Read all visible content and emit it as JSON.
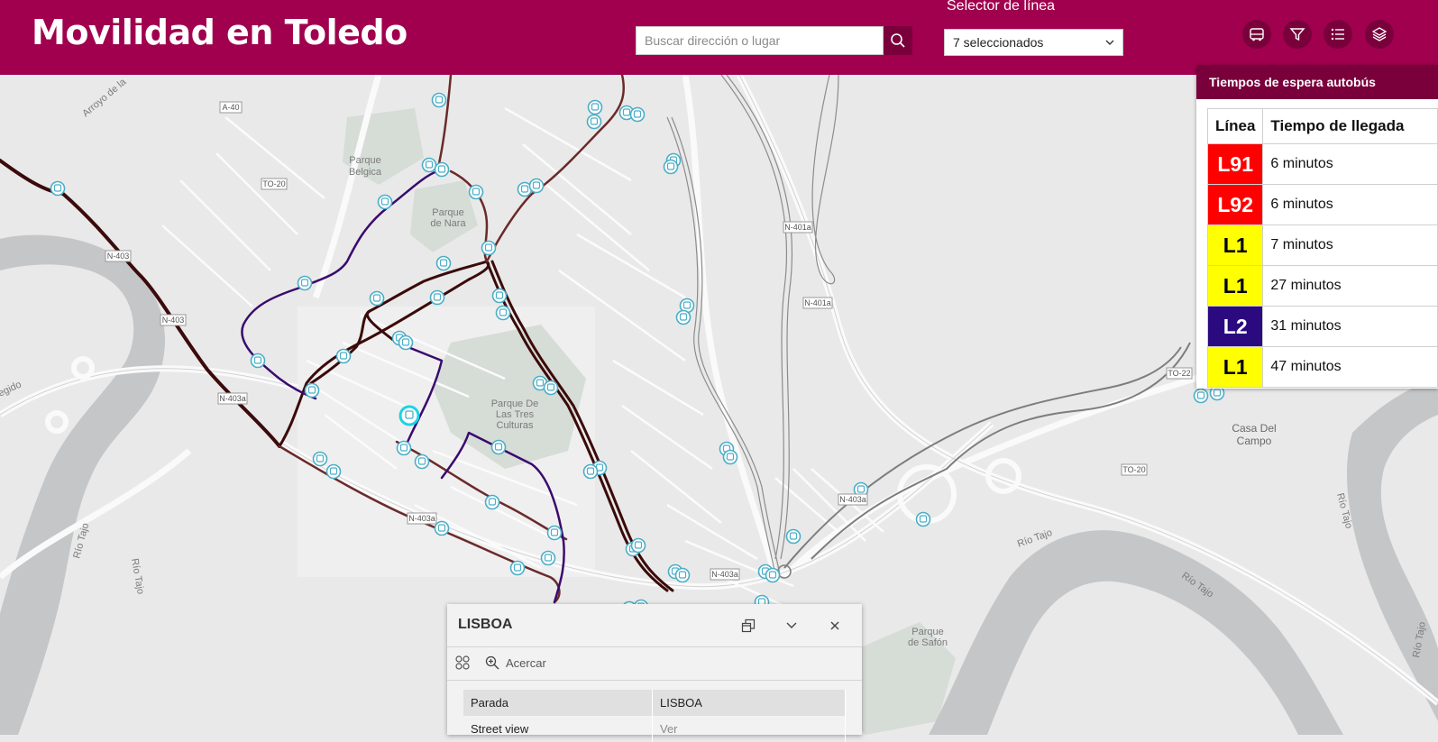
{
  "header": {
    "title": "Movilidad en Toledo",
    "search_placeholder": "Buscar dirección o lugar",
    "line_selector": {
      "label": "Selector de línea",
      "value": "7 seleccionados"
    },
    "buttons": [
      {
        "name": "bus-icon"
      },
      {
        "name": "filter-icon"
      },
      {
        "name": "list-icon"
      },
      {
        "name": "layers-icon"
      }
    ]
  },
  "map": {
    "labels": {
      "parque_belgica": [
        "Parque",
        "Belgica"
      ],
      "parque_nara": [
        "Parque",
        "de Nara"
      ],
      "parque_tres_culturas": [
        "Parque De",
        "Las Tres",
        "Culturas"
      ],
      "casa_campo": [
        "Casa Del",
        "Campo"
      ],
      "parque_safon": [
        "Parque",
        "de Safón"
      ],
      "arroyo": "Arroyo de la",
      "egido": "egido",
      "rio_tajo": "Río Tajo"
    },
    "road_shields": {
      "a40": "A-40",
      "to20": "TO-20",
      "n403": "N-403",
      "n403a": "N-403a",
      "n401a": "N-401a",
      "to22": "TO-22"
    },
    "colors": {
      "route_dark": "#3b0a0a",
      "route_brown": "#6b2a2a",
      "route_purple": "#3a0a6e",
      "stop": "#4aaec6",
      "selected": "#19d4e6"
    }
  },
  "wait_times": {
    "title": "Tiempos de espera autobús",
    "columns": [
      "Línea",
      "Tiempo de llegada"
    ],
    "rows": [
      {
        "line": "L91",
        "time": "6 minutos",
        "bg": "#ff0000",
        "fg": "#ffffff"
      },
      {
        "line": "L92",
        "time": "6 minutos",
        "bg": "#ff0000",
        "fg": "#ffffff"
      },
      {
        "line": "L1",
        "time": "7 minutos",
        "bg": "#ffff00",
        "fg": "#000000"
      },
      {
        "line": "L1",
        "time": "27 minutos",
        "bg": "#ffff00",
        "fg": "#000000"
      },
      {
        "line": "L2",
        "time": "31 minutos",
        "bg": "#2a0a7e",
        "fg": "#ffffff"
      },
      {
        "line": "L1",
        "time": "47 minutos",
        "bg": "#ffff00",
        "fg": "#000000"
      }
    ]
  },
  "popup": {
    "title": "LISBOA",
    "zoom_label": "Acercar",
    "rows": [
      {
        "key": "Parada",
        "value": "LISBOA"
      },
      {
        "key": "Street view",
        "value": "Ver"
      }
    ]
  }
}
